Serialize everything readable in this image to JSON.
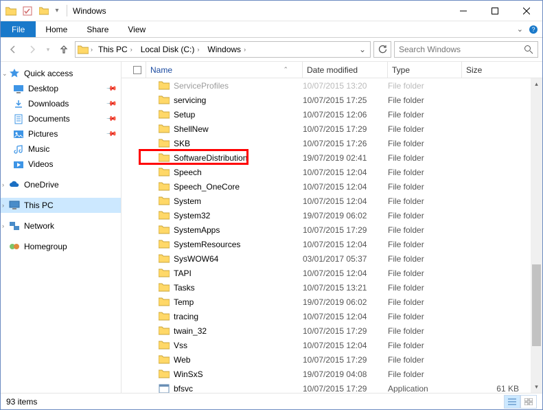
{
  "window": {
    "title": "Windows"
  },
  "menu": {
    "file": "File",
    "home": "Home",
    "share": "Share",
    "view": "View"
  },
  "breadcrumbs": [
    "This PC",
    "Local Disk (C:)",
    "Windows"
  ],
  "search": {
    "placeholder": "Search Windows"
  },
  "sidebar": {
    "quick_access": {
      "label": "Quick access",
      "items": [
        {
          "label": "Desktop",
          "icon": "desktop",
          "pinned": true
        },
        {
          "label": "Downloads",
          "icon": "downloads",
          "pinned": true
        },
        {
          "label": "Documents",
          "icon": "documents",
          "pinned": true
        },
        {
          "label": "Pictures",
          "icon": "pictures",
          "pinned": true
        },
        {
          "label": "Music",
          "icon": "music",
          "pinned": false
        },
        {
          "label": "Videos",
          "icon": "videos",
          "pinned": false
        }
      ]
    },
    "onedrive": {
      "label": "OneDrive"
    },
    "this_pc": {
      "label": "This PC"
    },
    "network": {
      "label": "Network"
    },
    "homegroup": {
      "label": "Homegroup"
    }
  },
  "columns": {
    "name": "Name",
    "date": "Date modified",
    "type": "Type",
    "size": "Size"
  },
  "rows": [
    {
      "name": "ServiceProfiles",
      "date": "10/07/2015 13:20",
      "type": "File folder",
      "size": "",
      "icon": "folder",
      "cut": true
    },
    {
      "name": "servicing",
      "date": "10/07/2015 17:25",
      "type": "File folder",
      "size": "",
      "icon": "folder"
    },
    {
      "name": "Setup",
      "date": "10/07/2015 12:06",
      "type": "File folder",
      "size": "",
      "icon": "folder"
    },
    {
      "name": "ShellNew",
      "date": "10/07/2015 17:29",
      "type": "File folder",
      "size": "",
      "icon": "folder"
    },
    {
      "name": "SKB",
      "date": "10/07/2015 17:26",
      "type": "File folder",
      "size": "",
      "icon": "folder"
    },
    {
      "name": "SoftwareDistribution",
      "date": "19/07/2019 02:41",
      "type": "File folder",
      "size": "",
      "icon": "folder",
      "highlight": true
    },
    {
      "name": "Speech",
      "date": "10/07/2015 12:04",
      "type": "File folder",
      "size": "",
      "icon": "folder"
    },
    {
      "name": "Speech_OneCore",
      "date": "10/07/2015 12:04",
      "type": "File folder",
      "size": "",
      "icon": "folder"
    },
    {
      "name": "System",
      "date": "10/07/2015 12:04",
      "type": "File folder",
      "size": "",
      "icon": "folder"
    },
    {
      "name": "System32",
      "date": "19/07/2019 06:02",
      "type": "File folder",
      "size": "",
      "icon": "folder"
    },
    {
      "name": "SystemApps",
      "date": "10/07/2015 17:29",
      "type": "File folder",
      "size": "",
      "icon": "folder"
    },
    {
      "name": "SystemResources",
      "date": "10/07/2015 12:04",
      "type": "File folder",
      "size": "",
      "icon": "folder"
    },
    {
      "name": "SysWOW64",
      "date": "03/01/2017 05:37",
      "type": "File folder",
      "size": "",
      "icon": "folder"
    },
    {
      "name": "TAPI",
      "date": "10/07/2015 12:04",
      "type": "File folder",
      "size": "",
      "icon": "folder"
    },
    {
      "name": "Tasks",
      "date": "10/07/2015 13:21",
      "type": "File folder",
      "size": "",
      "icon": "folder"
    },
    {
      "name": "Temp",
      "date": "19/07/2019 06:02",
      "type": "File folder",
      "size": "",
      "icon": "folder"
    },
    {
      "name": "tracing",
      "date": "10/07/2015 12:04",
      "type": "File folder",
      "size": "",
      "icon": "folder"
    },
    {
      "name": "twain_32",
      "date": "10/07/2015 17:29",
      "type": "File folder",
      "size": "",
      "icon": "folder"
    },
    {
      "name": "Vss",
      "date": "10/07/2015 12:04",
      "type": "File folder",
      "size": "",
      "icon": "folder"
    },
    {
      "name": "Web",
      "date": "10/07/2015 17:29",
      "type": "File folder",
      "size": "",
      "icon": "folder"
    },
    {
      "name": "WinSxS",
      "date": "19/07/2019 04:08",
      "type": "File folder",
      "size": "",
      "icon": "folder"
    },
    {
      "name": "bfsvc",
      "date": "10/07/2015 17:29",
      "type": "Application",
      "size": "61 KB",
      "icon": "app"
    }
  ],
  "status": {
    "count": "93 items"
  }
}
